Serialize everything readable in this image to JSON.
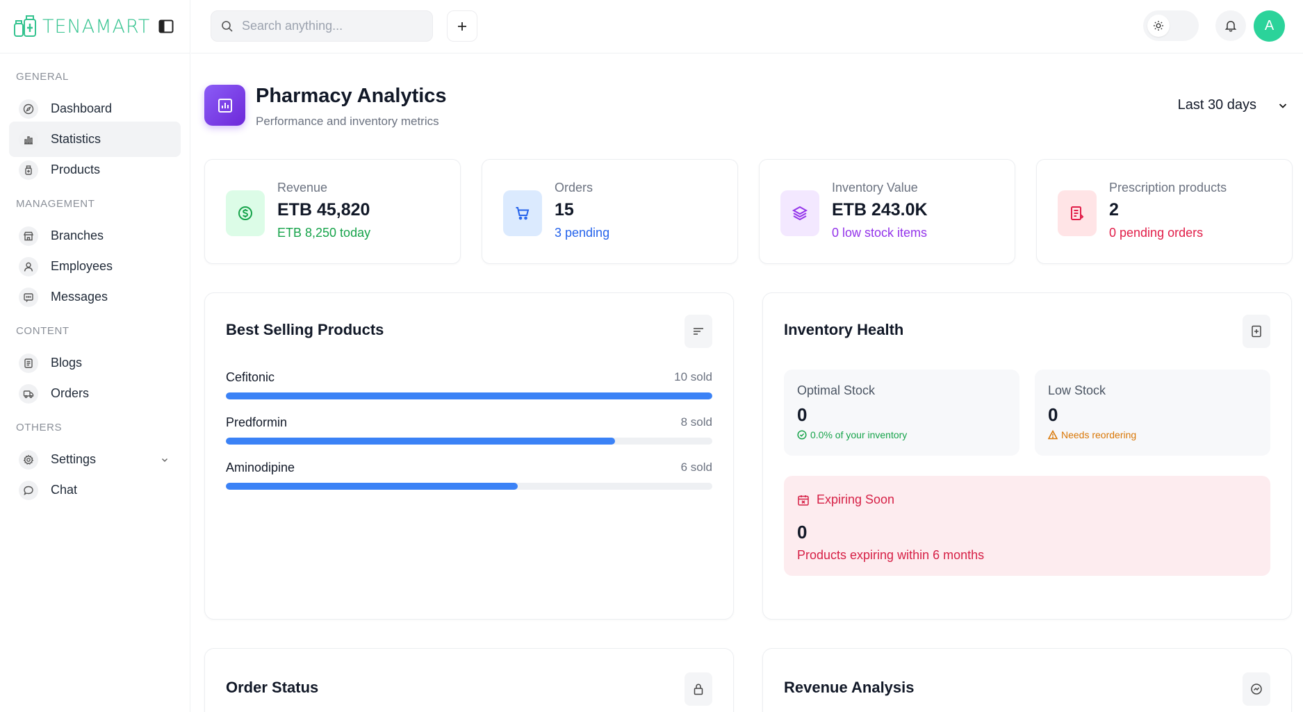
{
  "app": {
    "logo_text": "TENAMART"
  },
  "search": {
    "placeholder": "Search anything..."
  },
  "user": {
    "avatar_initial": "A"
  },
  "sidebar": {
    "sections": [
      {
        "label": "GENERAL",
        "items": [
          {
            "label": "Dashboard",
            "icon": "compass-icon"
          },
          {
            "label": "Statistics",
            "icon": "bar-chart-icon",
            "active": true
          },
          {
            "label": "Products",
            "icon": "bottle-icon"
          }
        ]
      },
      {
        "label": "MANAGEMENT",
        "items": [
          {
            "label": "Branches",
            "icon": "store-icon"
          },
          {
            "label": "Employees",
            "icon": "user-icon"
          },
          {
            "label": "Messages",
            "icon": "message-icon"
          }
        ]
      },
      {
        "label": "CONTENT",
        "items": [
          {
            "label": "Blogs",
            "icon": "document-icon"
          },
          {
            "label": "Orders",
            "icon": "truck-icon"
          }
        ]
      },
      {
        "label": "OTHERS",
        "items": [
          {
            "label": "Settings",
            "icon": "gear-icon"
          },
          {
            "label": "Chat",
            "icon": "chat-bubble-icon"
          }
        ]
      }
    ]
  },
  "header": {
    "title": "Pharmacy Analytics",
    "subtitle": "Performance and inventory metrics",
    "range": "Last 30 days"
  },
  "stats": [
    {
      "label": "Revenue",
      "value": "ETB 45,820",
      "sub": "ETB 8,250 today",
      "color": "#16a34a",
      "icon_bg": "#dcfce7"
    },
    {
      "label": "Orders",
      "value": "15",
      "sub": "3 pending",
      "color": "#2563eb",
      "icon_bg": "#dbeafe"
    },
    {
      "label": "Inventory Value",
      "value": "ETB 243.0K",
      "sub": "0 low stock items",
      "color": "#9333ea",
      "icon_bg": "#f3e8ff"
    },
    {
      "label": "Prescription products",
      "value": "2",
      "sub": "0 pending orders",
      "color": "#e11d48",
      "icon_bg": "#ffe4e6"
    }
  ],
  "best_selling": {
    "title": "Best Selling Products",
    "products": [
      {
        "name": "Cefitonic",
        "sold_label": "10 sold",
        "fraction": 1.0
      },
      {
        "name": "Predformin",
        "sold_label": "8 sold",
        "fraction": 0.8
      },
      {
        "name": "Aminodipine",
        "sold_label": "6 sold",
        "fraction": 0.6
      }
    ]
  },
  "inventory": {
    "title": "Inventory Health",
    "optimal": {
      "label": "Optimal Stock",
      "value": "0",
      "note": "0.0% of your inventory",
      "color": "#16a34a"
    },
    "low": {
      "label": "Low Stock",
      "value": "0",
      "note": "Needs reordering",
      "color": "#d97706"
    },
    "expiring": {
      "title": "Expiring Soon",
      "value": "0",
      "sub": "Products expiring within 6 months"
    }
  },
  "order_status": {
    "title": "Order Status"
  },
  "revenue_analysis": {
    "title": "Revenue Analysis"
  }
}
